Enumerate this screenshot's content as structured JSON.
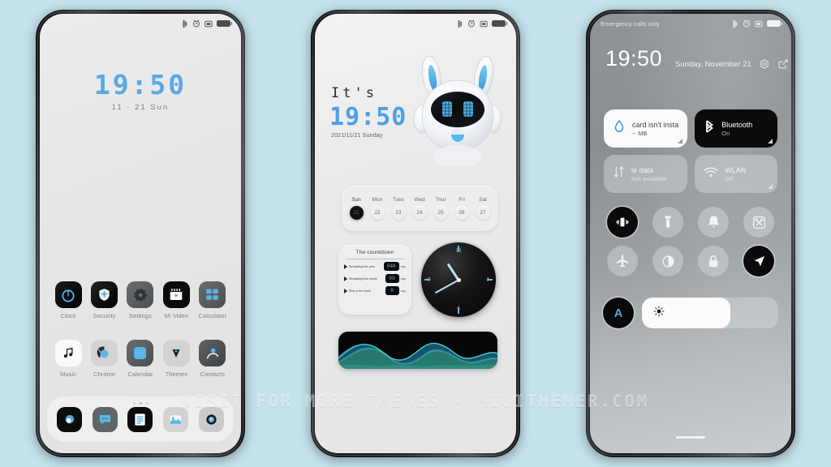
{
  "meta": {
    "watermark": "VISIT FOR MORE THEMES - MIUITHEMER.COM",
    "background_color": "#c5e2ec",
    "accent_color": "#4ea0e6"
  },
  "phone1": {
    "statusbar": {
      "icons": [
        "bluetooth-icon",
        "alarm-icon",
        "sim-card-icon",
        "battery-icon"
      ]
    },
    "clock": "19:50",
    "date": "11 · 21  Sun",
    "apps_row1": [
      {
        "label": "Clock",
        "icon": "clock-icon"
      },
      {
        "label": "Security",
        "icon": "shield-icon"
      },
      {
        "label": "Settings",
        "icon": "gear-icon"
      },
      {
        "label": "Mi Video",
        "icon": "video-icon"
      },
      {
        "label": "Calculator",
        "icon": "calculator-icon"
      }
    ],
    "apps_row2": [
      {
        "label": "Music",
        "icon": "music-note-icon"
      },
      {
        "label": "Chrome",
        "icon": "chrome-icon"
      },
      {
        "label": "Calendar",
        "icon": "calendar-icon"
      },
      {
        "label": "Themes",
        "icon": "themes-icon"
      },
      {
        "label": "Contacts",
        "icon": "contacts-icon"
      }
    ],
    "page_dots": {
      "count": 3,
      "active_index": 1
    },
    "dock": [
      {
        "label": "Camera",
        "icon": "camera-icon"
      },
      {
        "label": "Messaging",
        "icon": "message-bubble-icon"
      },
      {
        "label": "Notes",
        "icon": "notes-icon"
      },
      {
        "label": "Gallery",
        "icon": "gallery-icon"
      },
      {
        "label": "Browser",
        "icon": "browser-compass-icon"
      }
    ]
  },
  "phone2": {
    "statusbar": {
      "icons": [
        "bluetooth-icon",
        "alarm-icon",
        "sim-card-icon",
        "battery-icon"
      ]
    },
    "its_label": "It's",
    "time": "19:50",
    "date": "2021/11/21 Sunday",
    "mascot": "robot-mascot",
    "calendar": {
      "days": [
        {
          "dow": "Sun",
          "num": "21",
          "today": true
        },
        {
          "dow": "Mon",
          "num": "22",
          "today": false
        },
        {
          "dow": "Tues",
          "num": "23",
          "today": false
        },
        {
          "dow": "Wed",
          "num": "24",
          "today": false
        },
        {
          "dow": "Thur",
          "num": "25",
          "today": false
        },
        {
          "dow": "Fri",
          "num": "26",
          "today": false
        },
        {
          "dow": "Sat",
          "num": "27",
          "today": false
        }
      ]
    },
    "countdown": {
      "title": "The countdown",
      "rows": [
        {
          "label": "Remaining this year",
          "value": "040",
          "unit": "day"
        },
        {
          "label": "Remaining this month",
          "value": "09",
          "unit": "day"
        },
        {
          "label": "Rest of the week",
          "value": "0",
          "unit": "day"
        }
      ]
    },
    "analog_clock": {
      "numerals": [
        "12",
        "3",
        "6",
        "9"
      ],
      "hour_angle_deg": -57,
      "minute_angle_deg": 120
    },
    "wave_widget": {
      "name": "audio-wave-visualizer"
    }
  },
  "phone3": {
    "statusbar": {
      "carrier": "Emergency calls only",
      "icons": [
        "bluetooth-icon",
        "alarm-icon",
        "sim-card-icon",
        "battery-icon"
      ]
    },
    "time": "19:50",
    "date": "Sunday, November 21",
    "header_icons": [
      "settings-gear-icon",
      "edit-icon"
    ],
    "tiles": [
      {
        "title": "card isn't insta",
        "sub": "-- MB",
        "icon": "sim-water-drop-icon",
        "state": "white"
      },
      {
        "title": "Bluetooth",
        "sub": "On",
        "icon": "bluetooth-icon",
        "state": "black"
      },
      {
        "title": "le data",
        "sub": "Not available",
        "icon": "mobile-data-icon",
        "state": "off"
      },
      {
        "title": "WLAN",
        "sub": "Off",
        "icon": "wifi-icon",
        "state": "off"
      }
    ],
    "toggles": [
      {
        "name": "vibrate-toggle",
        "icon": "vibrate-icon",
        "active": true
      },
      {
        "name": "flashlight-toggle",
        "icon": "flashlight-icon",
        "active": false
      },
      {
        "name": "ringtone-toggle",
        "icon": "bell-icon",
        "active": false
      },
      {
        "name": "screenshot-toggle",
        "icon": "screenshot-icon",
        "active": false
      },
      {
        "name": "airplane-toggle",
        "icon": "airplane-icon",
        "active": false
      },
      {
        "name": "darkmode-toggle",
        "icon": "contrast-icon",
        "active": false
      },
      {
        "name": "lock-toggle",
        "icon": "lock-icon",
        "active": false
      },
      {
        "name": "location-toggle",
        "icon": "location-arrow-icon",
        "active": true
      }
    ],
    "brightness": {
      "auto_label": "A",
      "icon": "brightness-sun-icon",
      "level_percent": 65
    }
  }
}
